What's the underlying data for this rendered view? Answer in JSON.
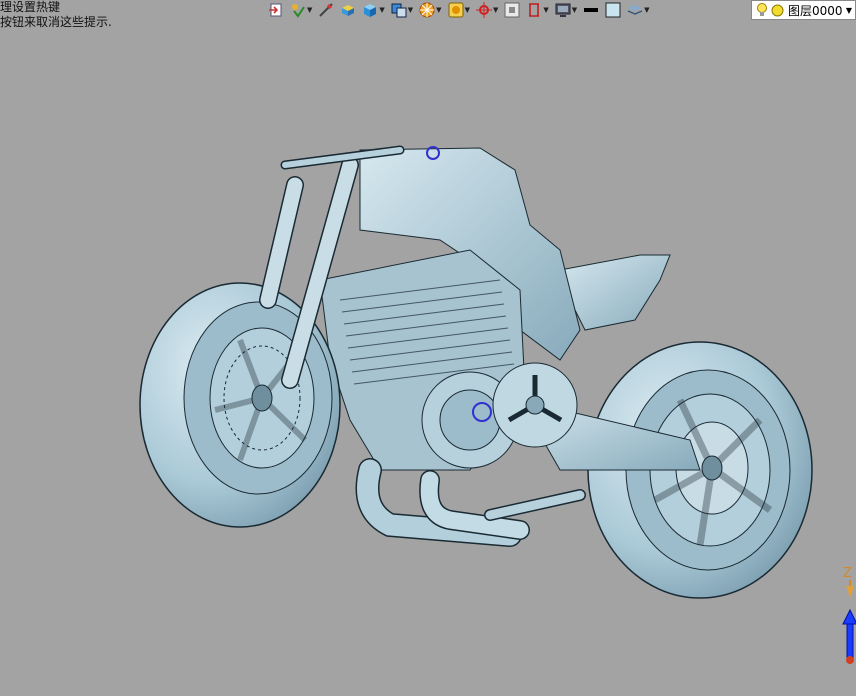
{
  "hint": {
    "line1": "理设置热键",
    "line2": "按钮来取消这些提示."
  },
  "toolbar": {
    "buttons": [
      {
        "name": "import-button",
        "icon": "import-icon",
        "dropdown": false
      },
      {
        "name": "snap-button",
        "icon": "snap-icon",
        "dropdown": true
      },
      {
        "name": "measure-button",
        "icon": "measure-icon",
        "dropdown": false
      },
      {
        "name": "shading-button",
        "icon": "shading-icon",
        "dropdown": false
      },
      {
        "name": "solid-button",
        "icon": "solid-cube-icon",
        "dropdown": true
      },
      {
        "name": "view-button",
        "icon": "view-cube-icon",
        "dropdown": true
      },
      {
        "name": "render-button",
        "icon": "render-icon",
        "dropdown": true
      },
      {
        "name": "surface-button",
        "icon": "surface-icon",
        "dropdown": true
      },
      {
        "name": "origin-button",
        "icon": "origin-icon",
        "dropdown": true
      },
      {
        "name": "grid-button",
        "icon": "grid-icon",
        "dropdown": false
      },
      {
        "name": "plane-button",
        "icon": "plane-icon",
        "dropdown": true
      },
      {
        "name": "display-button",
        "icon": "display-icon",
        "dropdown": true
      },
      {
        "name": "line-color-button",
        "icon": "line-color-icon",
        "dropdown": false
      },
      {
        "name": "fill-color-button",
        "icon": "fill-color-icon",
        "dropdown": false
      },
      {
        "name": "layers-button",
        "icon": "layers-icon",
        "dropdown": true
      }
    ]
  },
  "layer": {
    "label": "图层0000",
    "icons": [
      "lightbulb-icon",
      "layer-state-icon"
    ]
  },
  "triad": {
    "z_label": "Z"
  },
  "colors": {
    "background": "#a3a3a3",
    "model": "#b9d4df",
    "model_shadow": "#7fa3b4",
    "edge": "#1a2a33",
    "triad_z": "#1a3cff",
    "triad_label": "#d08a2a"
  }
}
